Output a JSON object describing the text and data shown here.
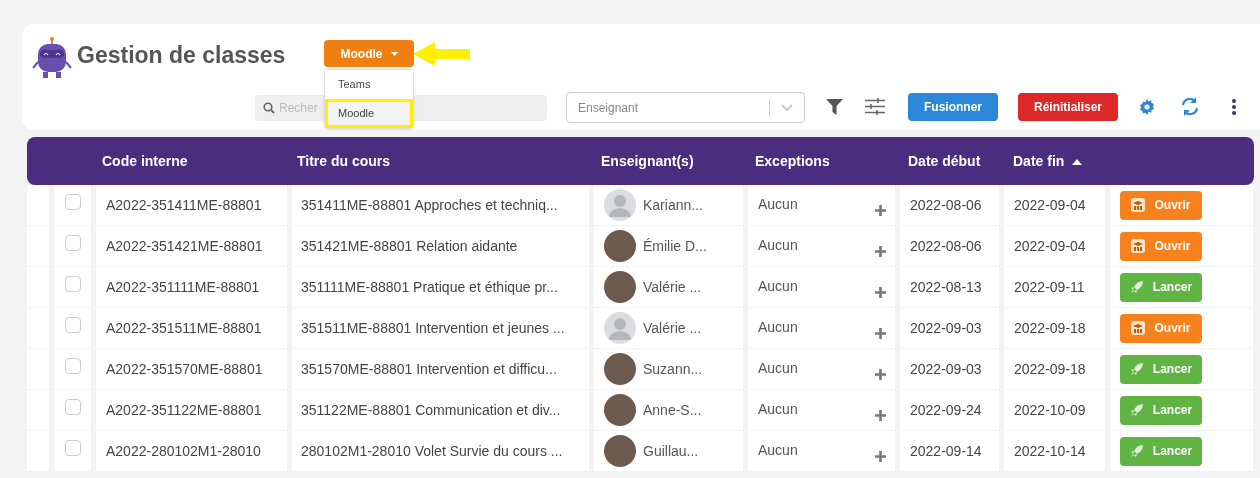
{
  "header": {
    "title": "Gestion de classes",
    "platform_button": "Moodle",
    "platform_menu": [
      {
        "label": "Teams",
        "selected": false,
        "highlighted": false
      },
      {
        "label": "Moodle",
        "selected": true,
        "highlighted": true
      }
    ],
    "search": {
      "placeholder": "Recher"
    },
    "teacher_select": {
      "placeholder": "Enseignant"
    },
    "buttons": [
      {
        "label": "Fusionner",
        "kind": "merge"
      },
      {
        "label": "Réinitialiser",
        "kind": "reset"
      }
    ]
  },
  "table": {
    "columns": [
      {
        "label": "Code interne",
        "sorted": false
      },
      {
        "label": "Titre du cours",
        "sorted": false
      },
      {
        "label": "Enseignant(s)",
        "sorted": false
      },
      {
        "label": "Exceptions",
        "sorted": false
      },
      {
        "label": "Date début",
        "sorted": false
      },
      {
        "label": "Date fin",
        "sorted": true
      }
    ],
    "rows": [
      {
        "checked": false,
        "code": "A2022-351411ME-88801",
        "title": "351411ME-88801 Approches et techniq...",
        "teacher": "Kariann...",
        "default_avatar": true,
        "exceptions": "Aucun",
        "start": "2022-08-06",
        "end": "2022-09-04",
        "action": {
          "kind": "open",
          "label": "Ouvrir"
        }
      },
      {
        "checked": false,
        "code": "A2022-351421ME-88801",
        "title": "351421ME-88801 Relation aidante",
        "teacher": "Émilie D...",
        "default_avatar": false,
        "exceptions": "Aucun",
        "start": "2022-08-06",
        "end": "2022-09-04",
        "action": {
          "kind": "open",
          "label": "Ouvrir"
        }
      },
      {
        "checked": false,
        "code": "A2022-351111ME-88801",
        "title": "351111ME-88801 Pratique et éthique pr...",
        "teacher": "Valérie ...",
        "default_avatar": false,
        "exceptions": "Aucun",
        "start": "2022-08-13",
        "end": "2022-09-11",
        "action": {
          "kind": "launch",
          "label": "Lancer"
        }
      },
      {
        "checked": false,
        "code": "A2022-351511ME-88801",
        "title": "351511ME-88801 Intervention et jeunes ...",
        "teacher": "Valérie ...",
        "default_avatar": true,
        "exceptions": "Aucun",
        "start": "2022-09-03",
        "end": "2022-09-18",
        "action": {
          "kind": "open",
          "label": "Ouvrir"
        }
      },
      {
        "checked": false,
        "code": "A2022-351570ME-88801",
        "title": "351570ME-88801 Intervention et difficu...",
        "teacher": "Suzann...",
        "default_avatar": false,
        "exceptions": "Aucun",
        "start": "2022-09-03",
        "end": "2022-09-18",
        "action": {
          "kind": "launch",
          "label": "Lancer"
        }
      },
      {
        "checked": false,
        "code": "A2022-351122ME-88801",
        "title": "351122ME-88801 Communication et div...",
        "teacher": "Anne-S...",
        "default_avatar": false,
        "exceptions": "Aucun",
        "start": "2022-09-24",
        "end": "2022-10-09",
        "action": {
          "kind": "launch",
          "label": "Lancer"
        }
      },
      {
        "checked": false,
        "code": "A2022-280102M1-28010",
        "title": "280102M1-28010 Volet Survie du cours ...",
        "teacher": "Guillau...",
        "default_avatar": false,
        "exceptions": "Aucun",
        "start": "2022-09-14",
        "end": "2022-10-14",
        "action": {
          "kind": "launch",
          "label": "Lancer"
        }
      }
    ]
  }
}
